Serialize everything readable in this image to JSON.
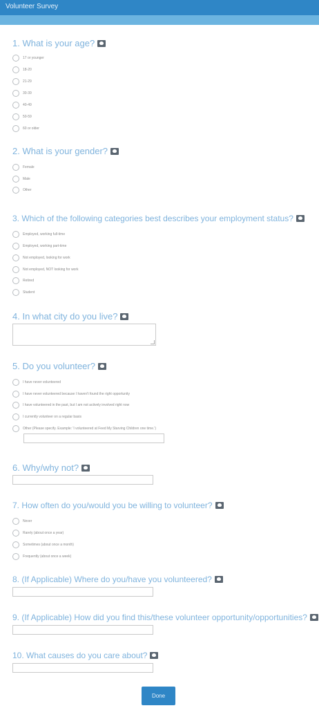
{
  "header": {
    "title": "Volunteer Survey"
  },
  "q1": {
    "title": "1. What is your age?",
    "options": [
      "17 or younger",
      "18-20",
      "21-29",
      "30-39",
      "40-49",
      "50-59",
      "60 or older"
    ]
  },
  "q2": {
    "title": "2. What is your gender?",
    "options": [
      "Female",
      "Male",
      "Other"
    ]
  },
  "q3": {
    "title": "3. Which of the following categories best describes your employment status?",
    "options": [
      "Employed, working full-time",
      "Employed, working part-time",
      "Not employed, looking for work",
      "Not employed, NOT looking for work",
      "Retired",
      "Student"
    ]
  },
  "q4": {
    "title": "4. In what city do you live?"
  },
  "q5": {
    "title": "5. Do you volunteer?",
    "options": [
      "I have never volunteered",
      "I have never volunteered because I haven't found the right opportunity",
      "I have volunteered in the past, but I am not actively involved right now",
      "I currently volunteer on a regular basis",
      "Other (Please specify. Example: 'I volunteered at Feed My Starving Children one time.')"
    ]
  },
  "q6": {
    "title": "6. Why/why not?"
  },
  "q7": {
    "title": "7. How often do you/would you be willing to volunteer?",
    "options": [
      "Never",
      "Rarely (about once a year)",
      "Sometimes (about once a month)",
      "Frequently (about once a week)"
    ]
  },
  "q8": {
    "title": "8. (If Applicable) Where do you/have you volunteered?"
  },
  "q9": {
    "title": "9. (If Applicable) How did you find this/these volunteer opportunity/opportunities?"
  },
  "q10": {
    "title": "10. What causes do you care about?"
  },
  "footer": {
    "done_label": "Done"
  }
}
